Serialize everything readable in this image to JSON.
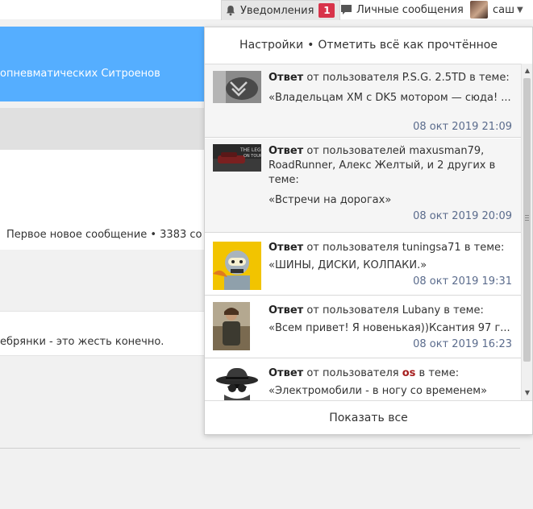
{
  "topbar": {
    "notifications_label": "Уведомления",
    "notifications_count": "1",
    "messages_label": "Личные сообщения",
    "username": "саш"
  },
  "background": {
    "banner_text": "опневматических Ситроенов",
    "topic_meta": "Первое новое сообщение • 3383 со",
    "post_snippet": "ебрянки - это жесть конечно."
  },
  "dropdown": {
    "header": {
      "settings_label": "Настройки",
      "separator": "•",
      "mark_all_read_label": "Отметить всё как прочтённое"
    },
    "notifications": [
      {
        "kind": "Ответ",
        "before_author": "от пользователя",
        "authors": "P.S.G. 2.5TD",
        "after_author": "в теме:",
        "quote": "«Владельцам XM с DK5 мотором — сюда! ...",
        "time": "08 окт 2019 21:09",
        "avatar": "car-grille-avatar"
      },
      {
        "kind": "Ответ",
        "before_author": "от пользователей",
        "authors": "maxusman79, RoadRunner, Алекс Желтый, и 2 других",
        "after_author": "в теме:",
        "quote": "«Встречи на дорогах»",
        "time": "08 окт 2019 20:09",
        "avatar": "car-road-avatar"
      },
      {
        "kind": "Ответ",
        "before_author": "от пользователя",
        "authors": "tuningsa71",
        "after_author": "в теме:",
        "quote": "«ШИНЫ, ДИСКИ, КОЛПАКИ.»",
        "time": "08 окт 2019 19:31",
        "avatar": "cartoon-robot-avatar"
      },
      {
        "kind": "Ответ",
        "before_author": "от пользователя",
        "authors": "Lubany",
        "after_author": "в теме:",
        "quote": "«Всем привет! Я новенькая))Ксантия 97 г...",
        "time": "08 окт 2019 16:23",
        "avatar": "person-photo-avatar"
      },
      {
        "kind": "Ответ",
        "before_author": "от пользователя",
        "authors": "os",
        "after_author": "в теме:",
        "quote": "«Электромобили - в ногу со временем»",
        "time": "",
        "avatar": "spy-hat-avatar"
      }
    ],
    "footer_label": "Показать все"
  },
  "colors": {
    "banner": "#55aeff",
    "badge": "#d8334a",
    "time_text": "#5a6b8c",
    "red_author": "#a51d1d"
  }
}
